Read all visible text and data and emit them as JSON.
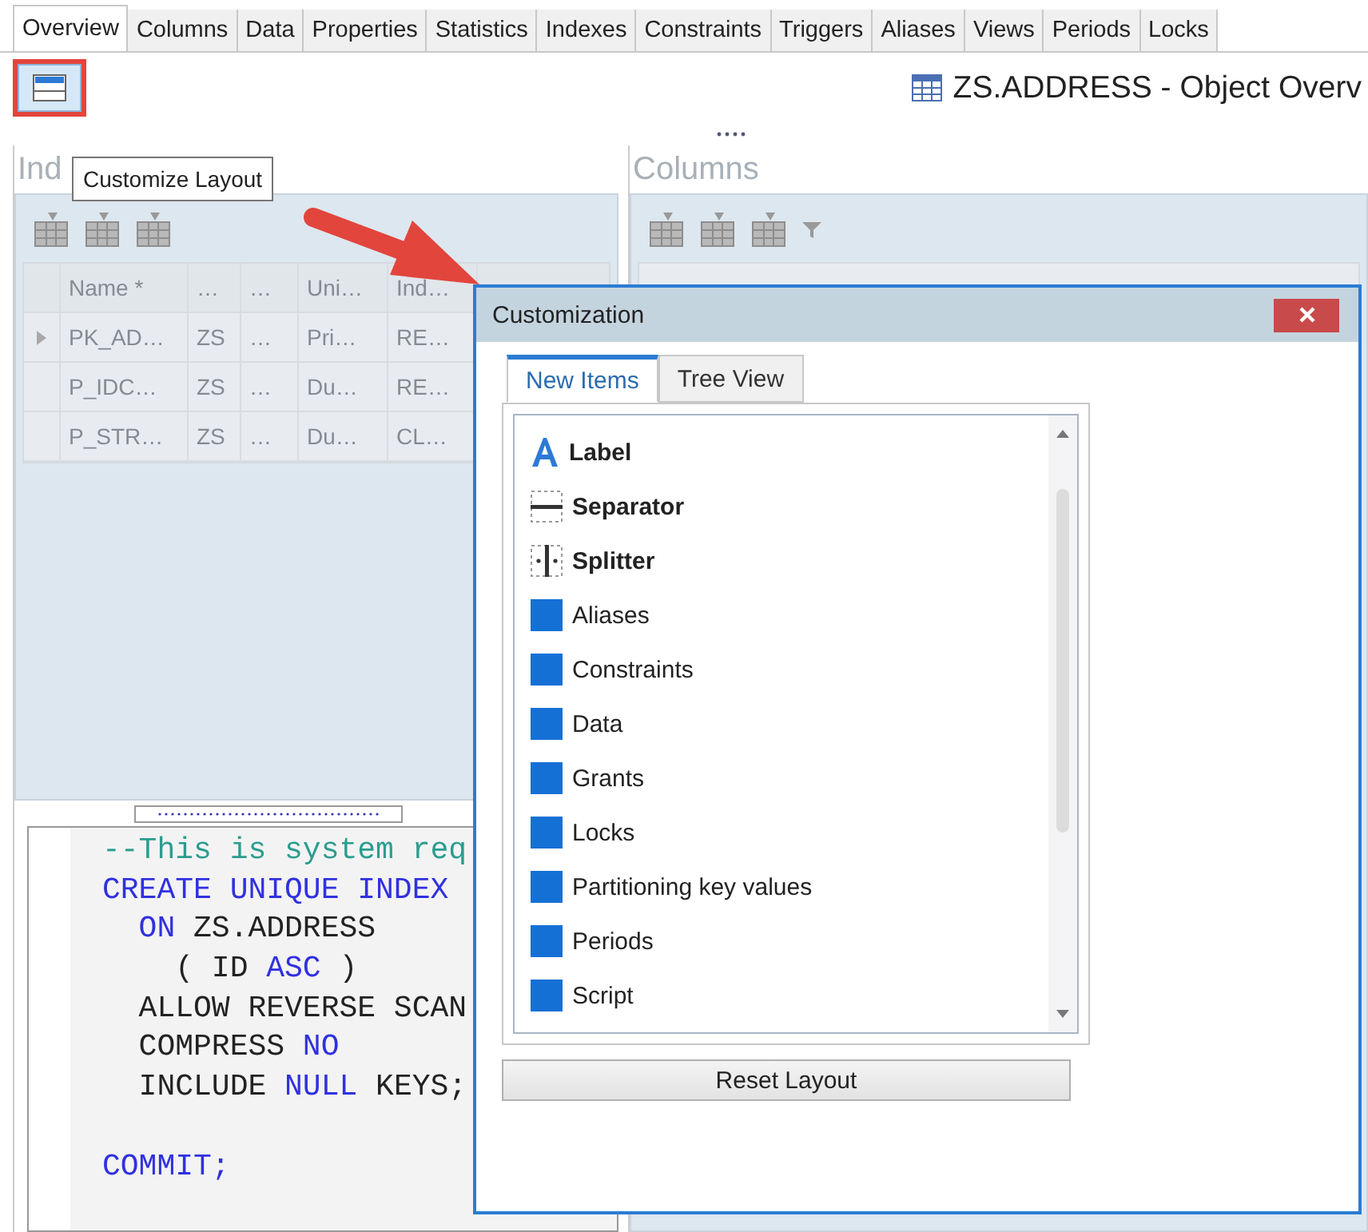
{
  "tabs": [
    {
      "label": "Overview",
      "selected": true
    },
    {
      "label": "Columns",
      "selected": false
    },
    {
      "label": "Data",
      "selected": false
    },
    {
      "label": "Properties",
      "selected": false
    },
    {
      "label": "Statistics",
      "selected": false
    },
    {
      "label": "Indexes",
      "selected": false
    },
    {
      "label": "Constraints",
      "selected": false
    },
    {
      "label": "Triggers",
      "selected": false
    },
    {
      "label": "Aliases",
      "selected": false
    },
    {
      "label": "Views",
      "selected": false
    },
    {
      "label": "Periods",
      "selected": false
    },
    {
      "label": "Locks",
      "selected": false
    }
  ],
  "title": "ZS.ADDRESS - Object Overv",
  "tooltip": "Customize Layout",
  "indexes_panel": {
    "title": "Ind",
    "grid": {
      "disabled": true,
      "columns": [
        "Name *",
        "…",
        "…",
        "Uni…",
        "Ind…"
      ],
      "rows": [
        {
          "current": true,
          "cells": [
            "PK_AD…",
            "ZS",
            "…",
            "Pri…",
            "RE…"
          ]
        },
        {
          "current": false,
          "cells": [
            "P_IDC…",
            "ZS",
            "…",
            "Du…",
            "RE…"
          ]
        },
        {
          "current": false,
          "cells": [
            "P_STR…",
            "ZS",
            "…",
            "Du…",
            "CL…"
          ]
        }
      ]
    },
    "code_blocks": [
      [
        [
          {
            "kind": "comment",
            "text": "--This is system req"
          }
        ],
        [
          {
            "kind": "keyword",
            "text": "CREATE UNIQUE INDEX"
          }
        ],
        [
          {
            "kind": "keyword",
            "text": "  ON"
          },
          {
            "kind": "plain",
            "text": " ZS.ADDRESS"
          }
        ],
        [
          {
            "kind": "plain",
            "text": "    ( ID "
          },
          {
            "kind": "keyword",
            "text": "ASC"
          },
          {
            "kind": "plain",
            "text": " )"
          }
        ],
        [
          {
            "kind": "plain",
            "text": "  ALLOW REVERSE SCAN"
          }
        ],
        [
          {
            "kind": "plain",
            "text": "  COMPRESS "
          },
          {
            "kind": "keyword",
            "text": "NO"
          }
        ],
        [
          {
            "kind": "plain",
            "text": "  INCLUDE "
          },
          {
            "kind": "keyword",
            "text": "NULL"
          },
          {
            "kind": "plain",
            "text": " KEYS;"
          }
        ]
      ],
      [
        [
          {
            "kind": "keyword",
            "text": "COMMIT;"
          }
        ]
      ]
    ]
  },
  "columns_panel": {
    "title": "Columns"
  },
  "dialog": {
    "title": "Customization",
    "tabs": [
      {
        "label": "New Items",
        "selected": true
      },
      {
        "label": "Tree View",
        "selected": false
      }
    ],
    "items": [
      {
        "kind": "label",
        "label": "Label"
      },
      {
        "kind": "separator",
        "label": "Separator"
      },
      {
        "kind": "splitter",
        "label": "Splitter"
      },
      {
        "kind": "item",
        "label": "Aliases"
      },
      {
        "kind": "item",
        "label": "Constraints"
      },
      {
        "kind": "item",
        "label": "Data"
      },
      {
        "kind": "item",
        "label": "Grants"
      },
      {
        "kind": "item",
        "label": "Locks"
      },
      {
        "kind": "item",
        "label": "Partitioning key values"
      },
      {
        "kind": "item",
        "label": "Periods"
      },
      {
        "kind": "item",
        "label": "Script"
      }
    ],
    "reset_button": "Reset Layout"
  }
}
